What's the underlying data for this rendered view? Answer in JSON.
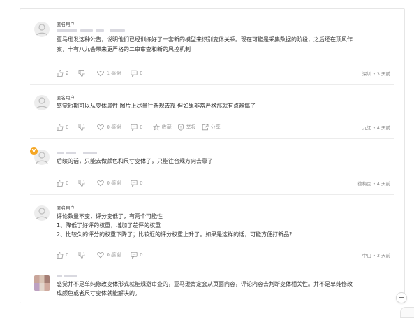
{
  "comments": [
    {
      "username": "匿名用户",
      "lines": [
        "亚马逊发这种公告，说明他们已经训练好了一套新的模型来识别变体关系。现在可能是采集数据的阶段，之后还在顶风作",
        "案，十有八九会带来更严格的二审审查和新的风控机制"
      ],
      "likes": "2",
      "thanks": "1 感谢",
      "replies": "0",
      "meta": "深圳 • 3 天前"
    },
    {
      "username": "匿名用户",
      "lines": [
        "感觉短期可以从变体属性 图片上尽量往新规去靠 但如果非常严格那就有点难搞了"
      ],
      "likes": "0",
      "thanks": "0 感谢",
      "replies": "0",
      "collect": "收藏",
      "report": "举报",
      "share": "分享",
      "meta": "九江 • 4 天前"
    },
    {
      "vip": "V",
      "lines": [
        "后续的话，只能去做颜色和尺寸变体了，只能往合规方向去靠了"
      ],
      "likes": "0",
      "thanks": "0 感谢",
      "replies": "0",
      "meta": "德梅因 • 4 天前"
    },
    {
      "username": "匿名用户",
      "lines": [
        "评论数量不变，评分变低了，有两个可能性",
        "1、降低了好评的权重，增加了差评的权重",
        "2、比较久的评分的权重下降了；比较近的评分权重上升了。如果是这样的话，可能方便打新品?"
      ],
      "likes": "0",
      "thanks": "0 感谢",
      "replies": "0",
      "meta": "中山 • 3 天前"
    },
    {
      "lines": [
        "感觉并不是单纯修改变体形式就能规避审查的，亚马逊肯定会从页面内容，评论内容去判断变体相关性。并不是单纯修改",
        "成颜色或者尺寸变体就能解决的。"
      ]
    }
  ],
  "icons": {
    "like": "thumbs-up-icon",
    "dislike": "thumbs-down-icon",
    "thanks": "heart-icon",
    "reply": "comment-icon",
    "collect": "star-icon",
    "report": "shield-icon",
    "share": "share-icon"
  }
}
